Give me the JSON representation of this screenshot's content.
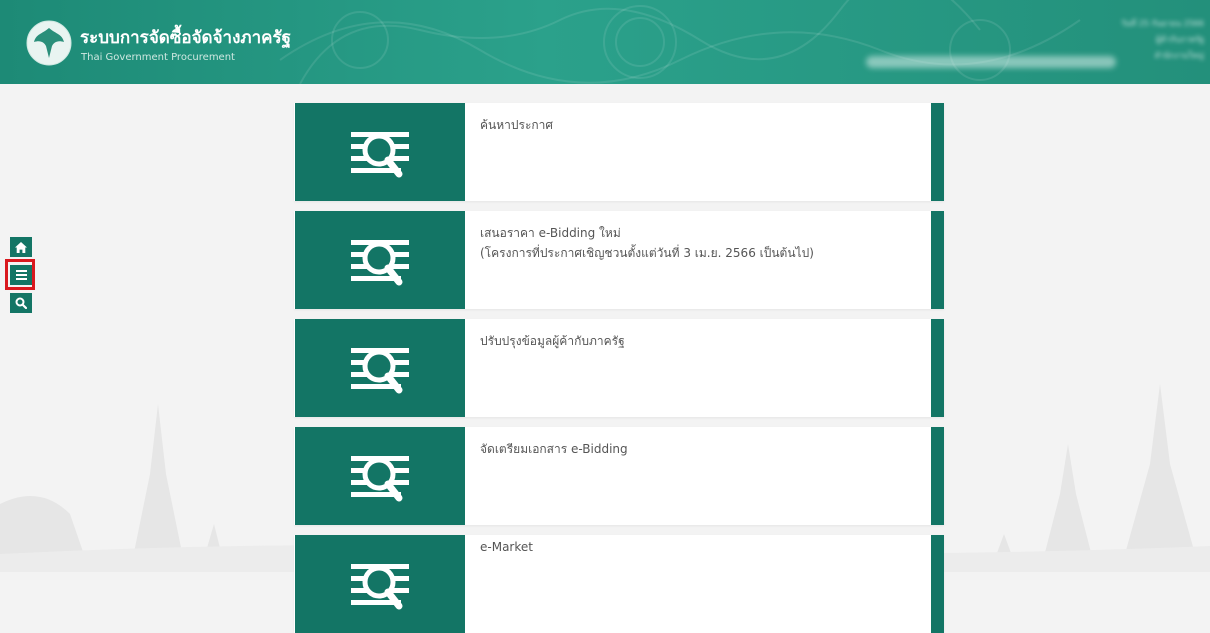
{
  "header": {
    "title": "ระบบการจัดซื้อจัดจ้างภาครัฐ",
    "subtitle": "Thai Government Procurement",
    "date": "วันที่ 25 กันยายน 2566",
    "role": "ผู้ค้ากับภาครัฐ",
    "office": "สำนักงานใหญ่"
  },
  "sidebar": {
    "home_icon": "home-icon",
    "menu_icon": "menu-icon",
    "search_icon": "search-icon"
  },
  "menu_items": [
    {
      "line1": "ค้นหาประกาศ",
      "line2": ""
    },
    {
      "line1": "เสนอราคา e-Bidding ใหม่",
      "line2": "(โครงการที่ประกาศเชิญชวนตั้งแต่วันที่ 3 เม.ย. 2566 เป็นต้นไป)"
    },
    {
      "line1": "ปรับปรุงข้อมูลผู้ค้ากับภาครัฐ",
      "line2": ""
    },
    {
      "line1": "จัดเตรียมเอกสาร e-Bidding",
      "line2": ""
    },
    {
      "line1": "e-Market",
      "line2": ""
    }
  ],
  "colors": {
    "header_teal": "#1d8a76",
    "card_green": "#137565",
    "highlight_red": "#d9181e"
  }
}
